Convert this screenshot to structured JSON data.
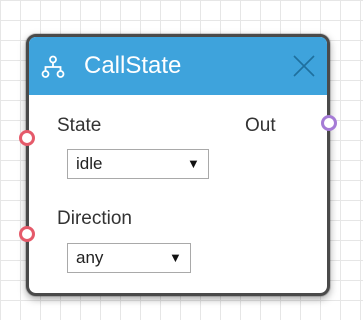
{
  "node": {
    "title": "CallState",
    "header_color": "#3ea3dc",
    "header_icon": "network-icon",
    "close_icon": "close-icon",
    "inputs": [
      {
        "label": "State",
        "value": "idle",
        "arrow": "▼"
      },
      {
        "label": "Direction",
        "value": "any",
        "arrow": "▼"
      }
    ],
    "outputs": [
      {
        "label": "Out"
      }
    ],
    "input_port_color": "#e55a6a",
    "output_port_color": "#a57bd6"
  }
}
